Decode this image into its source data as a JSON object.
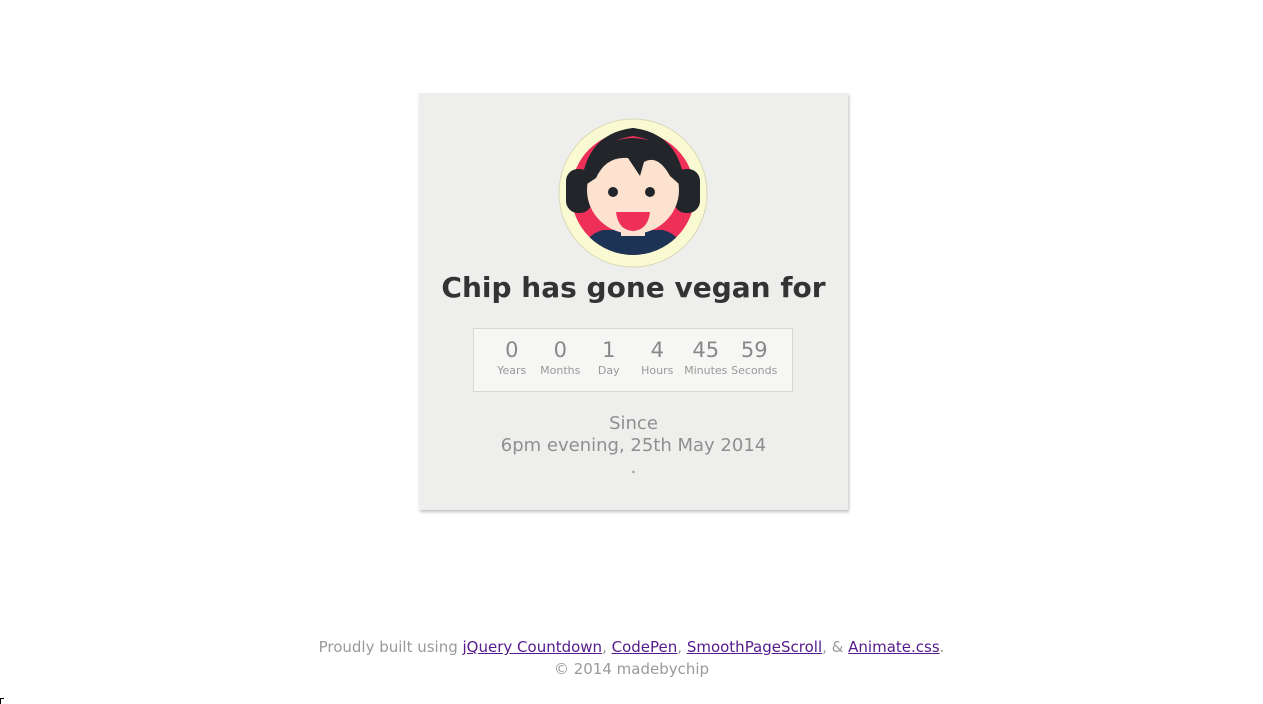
{
  "heading": "Chip has gone vegan for",
  "countdown": [
    {
      "value": "0",
      "label": "Years"
    },
    {
      "value": "0",
      "label": "Months"
    },
    {
      "value": "1",
      "label": "Day"
    },
    {
      "value": "4",
      "label": "Hours"
    },
    {
      "value": "45",
      "label": "Minutes"
    },
    {
      "value": "59",
      "label": "Seconds"
    }
  ],
  "since": {
    "line1": "Since",
    "line2": "6pm evening, 25th May 2014",
    "line3": "."
  },
  "footer": {
    "prefix": "Proudly built using ",
    "links": [
      "jQuery Countdown",
      "CodePen",
      "SmoothPageScroll",
      "Animate.css"
    ],
    "sep1": ", ",
    "sep2": ", ",
    "sep3": ", & ",
    "suffix": ".",
    "copyright": "© 2014 madebychip"
  },
  "colors": {
    "card_bg": "#eeeeec",
    "avatar_ring": "#fafad2",
    "avatar_red": "#ee3058",
    "hair": "#22262b",
    "skin": "#fde3cf",
    "shirt": "#1d3356",
    "link": "#551a8b"
  }
}
